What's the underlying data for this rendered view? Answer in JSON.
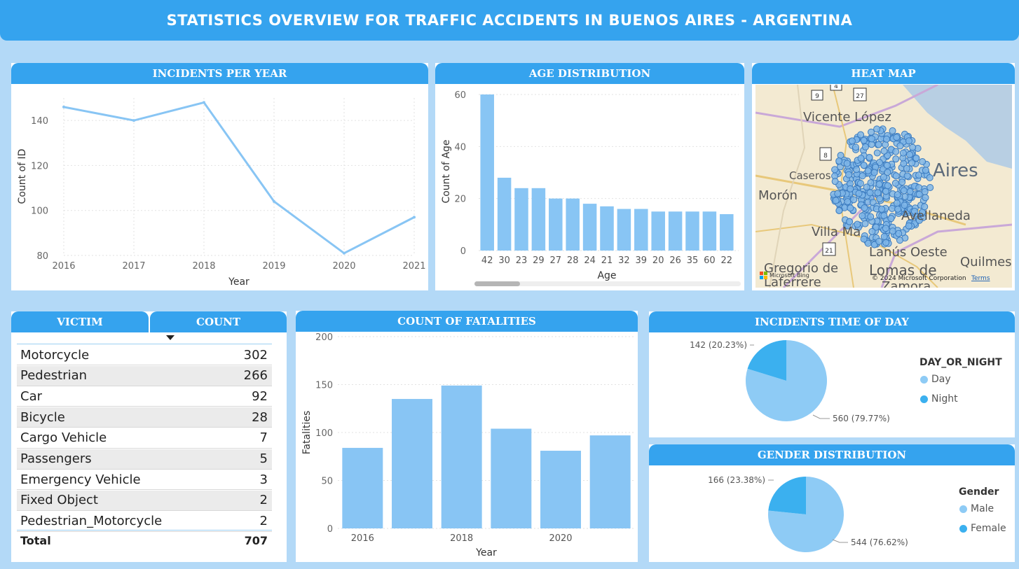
{
  "title": "STATISTICS OVERVIEW FOR TRAFFIC ACCIDENTS IN BUENOS AIRES - ARGENTINA",
  "colors": {
    "accent": "#35a3ee",
    "bar": "#88c5f4",
    "light": "#8ecbf5",
    "dark": "#3bb0ef",
    "bg": "#b3d9f7"
  },
  "panels": {
    "incidents_per_year": "INCIDENTS PER YEAR",
    "age_distribution": "AGE DISTRIBUTION",
    "heat_map": "HEAT MAP",
    "victim": "VICTIM",
    "count": "COUNT",
    "fatalities": "COUNT OF FATALITIES",
    "time_of_day": "INCIDENTS TIME OF DAY",
    "gender": "GENDER DISTRIBUTION"
  },
  "map": {
    "labels": [
      "Vicente López",
      "Aires",
      "Caseros",
      "Morón",
      "Villa Ma",
      "Avellaneda",
      "Lanús Oeste",
      "Quilmes",
      "Gregorio de",
      "Lomas de",
      "Laferrere",
      "Zamora"
    ],
    "attribution": "© 2024 Microsoft Corporation",
    "terms": "Terms",
    "bing": "Microsoft Bing",
    "road_shields": [
      "9",
      "4",
      "27",
      "8",
      "21"
    ]
  },
  "victim_table": {
    "rows": [
      {
        "victim": "Motorcycle",
        "count": "302"
      },
      {
        "victim": "Pedestrian",
        "count": "266"
      },
      {
        "victim": "Car",
        "count": "92"
      },
      {
        "victim": "Bicycle",
        "count": "28"
      },
      {
        "victim": "Cargo Vehicle",
        "count": "7"
      },
      {
        "victim": "Passengers",
        "count": "5"
      },
      {
        "victim": "Emergency Vehicle",
        "count": "3"
      },
      {
        "victim": "Fixed Object",
        "count": "2"
      },
      {
        "victim": "Pedestrian_Motorcycle",
        "count": "2"
      }
    ],
    "total_label": "Total",
    "total_value": "707"
  },
  "chart_data": [
    {
      "id": "incidents_per_year",
      "type": "line",
      "title": "INCIDENTS PER YEAR",
      "xlabel": "Year",
      "ylabel": "Count of ID",
      "x": [
        2016,
        2017,
        2018,
        2019,
        2020,
        2021
      ],
      "x_ticks": [
        "2016",
        "2017",
        "2018",
        "2019",
        "2020",
        "2021"
      ],
      "y": [
        146,
        140,
        148,
        104,
        81,
        97
      ],
      "ylim": [
        80,
        150
      ],
      "y_ticks": [
        80,
        100,
        120,
        140
      ],
      "grid": true
    },
    {
      "id": "age_distribution",
      "type": "bar",
      "title": "AGE DISTRIBUTION",
      "xlabel": "Age",
      "ylabel": "Count of Age",
      "categories": [
        "42",
        "30",
        "23",
        "29",
        "27",
        "28",
        "24",
        "21",
        "32",
        "39",
        "20",
        "26",
        "35",
        "60",
        "22"
      ],
      "values": [
        60,
        28,
        24,
        24,
        20,
        20,
        18,
        17,
        16,
        16,
        15,
        15,
        15,
        15,
        14
      ],
      "ylim": [
        0,
        60
      ],
      "y_ticks": [
        0,
        20,
        40,
        60
      ],
      "grid": true
    },
    {
      "id": "fatalities",
      "type": "bar",
      "title": "COUNT OF FATALITIES",
      "xlabel": "Year",
      "ylabel": "Fatalities",
      "categories": [
        "2016",
        "2017",
        "2018",
        "2019",
        "2020",
        "2021"
      ],
      "x_tick_labels": [
        "2016",
        "",
        "2018",
        "",
        "2020",
        ""
      ],
      "values": [
        84,
        135,
        149,
        104,
        81,
        97
      ],
      "ylim": [
        0,
        200
      ],
      "y_ticks": [
        0,
        50,
        100,
        150,
        200
      ],
      "grid": true
    },
    {
      "id": "time_of_day",
      "type": "pie",
      "title": "INCIDENTS TIME OF DAY",
      "legend_title": "DAY_OR_NIGHT",
      "legend_position": "right",
      "slices": [
        {
          "name": "Day",
          "value": 560,
          "label": "560 (79.77%)",
          "color": "#8ecbf5"
        },
        {
          "name": "Night",
          "value": 142,
          "label": "142 (20.23%)",
          "color": "#3bb0ef"
        }
      ]
    },
    {
      "id": "gender",
      "type": "pie",
      "title": "GENDER DISTRIBUTION",
      "legend_title": "Gender",
      "legend_position": "right",
      "slices": [
        {
          "name": "Male",
          "value": 544,
          "label": "544 (76.62%)",
          "color": "#8ecbf5"
        },
        {
          "name": "Female",
          "value": 166,
          "label": "166 (23.38%)",
          "color": "#3bb0ef"
        }
      ]
    }
  ]
}
